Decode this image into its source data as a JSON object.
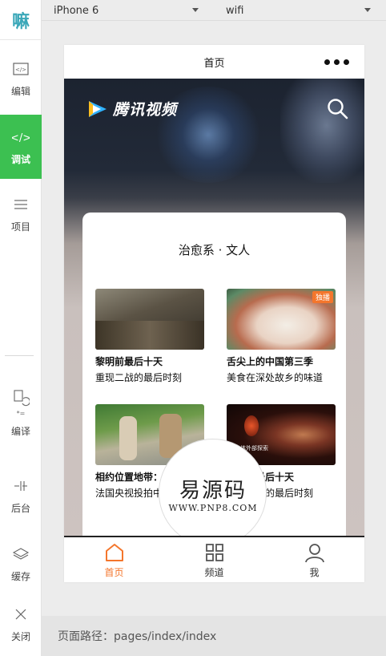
{
  "sidebar": {
    "logo": "嘛",
    "items": [
      {
        "label": "编辑",
        "icon": "code-window-icon"
      },
      {
        "label": "调试",
        "icon": "code-icon",
        "active": true
      },
      {
        "label": "项目",
        "icon": "menu-icon"
      },
      {
        "label": "编译",
        "icon": "compile-icon"
      },
      {
        "label": "后台",
        "icon": "split-icon"
      },
      {
        "label": "缓存",
        "icon": "layers-icon"
      },
      {
        "label": "关闭",
        "icon": "close-icon"
      }
    ]
  },
  "topbar": {
    "device": "iPhone 6",
    "network": "wifi"
  },
  "phone": {
    "nav_title": "首页",
    "brand": "腾讯视频",
    "section_title": "治愈系 · 文人",
    "videos": [
      {
        "title": "黎明前最后十天",
        "desc": "重现二战的最后时刻",
        "badge": ""
      },
      {
        "title": "舌尖上的中国第三季",
        "desc": "美食在深处故乡的味道",
        "badge": "独播"
      },
      {
        "title": "相约位置地带：贵州篇",
        "desc": "法国央视投拍中国宣...",
        "badge": ""
      },
      {
        "title": "黎明前最后十天",
        "desc": "重现二战的最后时刻",
        "badge": "",
        "caption": "人体外部探索"
      }
    ],
    "watermark": {
      "main": "易源码",
      "sub": "WWW.PNP8.COM"
    },
    "tabs": [
      {
        "label": "首页",
        "icon": "home-icon",
        "active": true
      },
      {
        "label": "频道",
        "icon": "grid-icon"
      },
      {
        "label": "我",
        "icon": "user-icon"
      }
    ],
    "accent": "#f4762c"
  },
  "footer": {
    "path": "页面路径：pages/index/index"
  }
}
